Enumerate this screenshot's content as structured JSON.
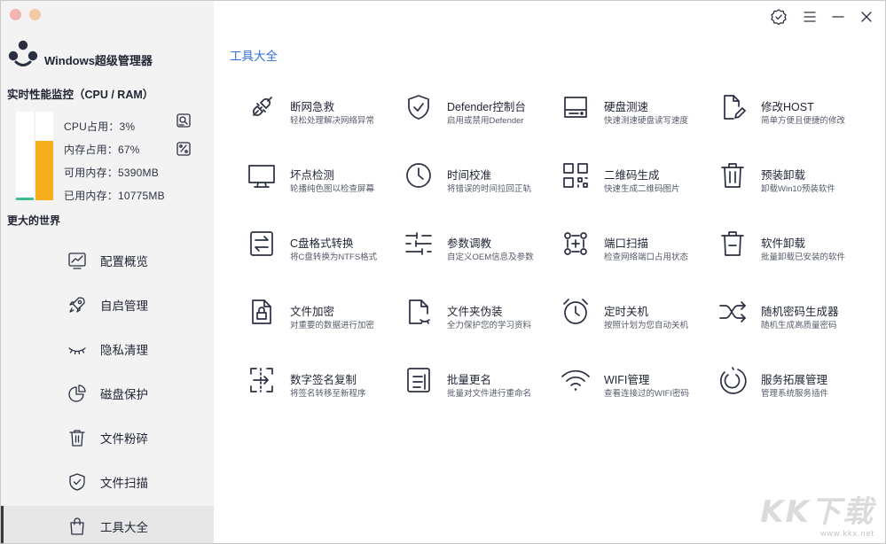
{
  "app": {
    "title": "Windows超级管理器"
  },
  "performance": {
    "title": "实时性能监控（CPU / RAM）",
    "cpu_label": "CPU占用：",
    "cpu_value": "3%",
    "cpu_fraction": 0.03,
    "mem_label": "内存占用：",
    "mem_value": "67%",
    "mem_fraction": 0.67,
    "avail_label": "可用内存：",
    "avail_value": "5390MB",
    "used_label": "已用内存：",
    "used_value": "10775MB",
    "colors": {
      "cpu": "#3dbd8c",
      "mem": "#f7ad1c"
    }
  },
  "sidebar": {
    "section_label": "更大的世界",
    "items": [
      {
        "label": "配置概览",
        "icon": "chart-monitor-icon"
      },
      {
        "label": "自启管理",
        "icon": "rocket-icon"
      },
      {
        "label": "隐私清理",
        "icon": "closed-eye-icon"
      },
      {
        "label": "磁盘保护",
        "icon": "pie-chart-icon"
      },
      {
        "label": "文件粉碎",
        "icon": "trash-icon"
      },
      {
        "label": "文件扫描",
        "icon": "shield-icon"
      },
      {
        "label": "工具大全",
        "icon": "bag-icon",
        "active": true
      }
    ]
  },
  "main": {
    "title": "工具大全",
    "accent": "#2f6fd6",
    "tools": [
      {
        "name": "断网急救",
        "desc": "轻松处理解决网络异常",
        "icon": "plug-icon"
      },
      {
        "name": "Defender控制台",
        "desc": "启用或禁用Defender",
        "icon": "shield-check-icon"
      },
      {
        "name": "硬盘测速",
        "desc": "快速测速硬盘读写速度",
        "icon": "hard-drive-icon"
      },
      {
        "name": "修改HOST",
        "desc": "简单方便且便捷的修改",
        "icon": "file-edit-icon"
      },
      {
        "name": "坏点检测",
        "desc": "轮播纯色图以检查屏幕",
        "icon": "monitor-icon"
      },
      {
        "name": "时间校准",
        "desc": "将错误的时间拉回正轨",
        "icon": "clock-icon"
      },
      {
        "name": "二维码生成",
        "desc": "快速生成二维码图片",
        "icon": "qr-code-icon"
      },
      {
        "name": "预装卸载",
        "desc": "卸载Win10预装软件",
        "icon": "trash-icon"
      },
      {
        "name": "C盘格式转换",
        "desc": "将C盘转换为NTFS格式",
        "icon": "swap-file-icon"
      },
      {
        "name": "参数调教",
        "desc": "自定义OEM信息及参数",
        "icon": "sliders-icon"
      },
      {
        "name": "端口扫描",
        "desc": "检查网络端口占用状态",
        "icon": "network-nodes-icon"
      },
      {
        "name": "软件卸载",
        "desc": "批量卸载已安装的软件",
        "icon": "trash-minus-icon"
      },
      {
        "name": "文件加密",
        "desc": "对重要的数据进行加密",
        "icon": "file-lock-icon"
      },
      {
        "name": "文件夹伪装",
        "desc": "全力保护您的学习资料",
        "icon": "file-disguise-icon"
      },
      {
        "name": "定时关机",
        "desc": "按照计划为您自动关机",
        "icon": "alarm-clock-icon"
      },
      {
        "name": "随机密码生成器",
        "desc": "随机生成高质量密码",
        "icon": "shuffle-icon"
      },
      {
        "name": "数字签名复制",
        "desc": "将签名转移至新程序",
        "icon": "signature-transfer-icon"
      },
      {
        "name": "批量更名",
        "desc": "批量对文件进行重命名",
        "icon": "rename-icon"
      },
      {
        "name": "WIFI管理",
        "desc": "查看连接过的WIFI密码",
        "icon": "wifi-icon"
      },
      {
        "name": "服务拓展管理",
        "desc": "管理系统服务插件",
        "icon": "service-ring-icon"
      }
    ]
  },
  "window_controls": {
    "icons": [
      "badge-check-icon",
      "menu-icon",
      "minimize-icon",
      "close-icon"
    ]
  },
  "watermark": {
    "big": "KK下载",
    "small": "www.kkx.net"
  }
}
